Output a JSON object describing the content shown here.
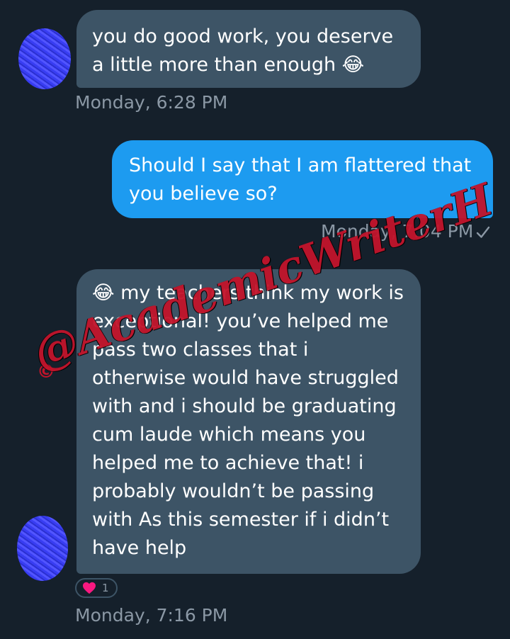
{
  "messages": [
    {
      "direction": "incoming",
      "lines": [
        "you do good work, you deserve",
        "a little more than enough 😂"
      ],
      "timestamp": "Monday, 6:28 PM"
    },
    {
      "direction": "outgoing",
      "lines": [
        "Should I say that I am flattered that",
        "you believe so?"
      ],
      "timestamp": "Monday, 7:04 PM",
      "status": "sent-check"
    },
    {
      "direction": "incoming",
      "lines": [
        "😂 my teachers think my work is",
        "exceptional! you’ve helped me",
        "pass two classes that i",
        "otherwise would have struggled",
        "with and i should be graduating",
        "cum laude which means you",
        "helped me to achieve that! i",
        "probably wouldn’t be passing",
        "with As this semester if i didn’t",
        "have help"
      ],
      "timestamp": "Monday, 7:16 PM",
      "reaction": {
        "icon": "heart-icon",
        "count": "1"
      }
    }
  ],
  "watermark": {
    "symbol": "©",
    "text": "@AcademicWriterH"
  },
  "colors": {
    "background": "#15202b",
    "incoming_bubble": "#3d5466",
    "outgoing_bubble": "#1d9bf0",
    "timestamp": "#8b98a5",
    "watermark": "#c2142b"
  }
}
